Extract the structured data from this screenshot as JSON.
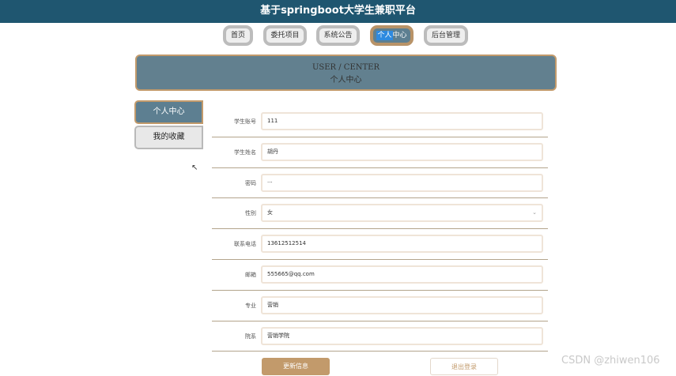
{
  "app_title": "基于springboot大学生兼职平台",
  "nav": [
    {
      "label": "首页",
      "active": false
    },
    {
      "label": "委托项目",
      "active": false
    },
    {
      "label": "系统公告",
      "active": false
    },
    {
      "label_hl": "个人",
      "label_rest": "中心",
      "active": true
    },
    {
      "label": "后台管理",
      "active": false
    }
  ],
  "header": {
    "en": "USER / CENTER",
    "cn": "个人中心"
  },
  "sidebar": [
    {
      "label": "个人中心",
      "active": true
    },
    {
      "label": "我的收藏",
      "active": false
    }
  ],
  "form": [
    {
      "label": "学生账号",
      "value": "111"
    },
    {
      "label": "学生姓名",
      "value": "胡丹"
    },
    {
      "label": "密码",
      "value": "···"
    },
    {
      "label": "性别",
      "value": "女"
    },
    {
      "label": "联系电话",
      "value": "13612512514"
    },
    {
      "label": "邮箱",
      "value": "555665@qq.com"
    },
    {
      "label": "专业",
      "value": "营销"
    },
    {
      "label": "院系",
      "value": "营销学院"
    }
  ],
  "buttons": {
    "save": "更新信息",
    "logout": "退出登录"
  },
  "select_chevron": "⌄",
  "watermark": "CSDN @zhiwen106",
  "colors": {
    "topbar": "#1f5670",
    "accent": "#c29a6b",
    "active_bg": "#5d7f91"
  }
}
